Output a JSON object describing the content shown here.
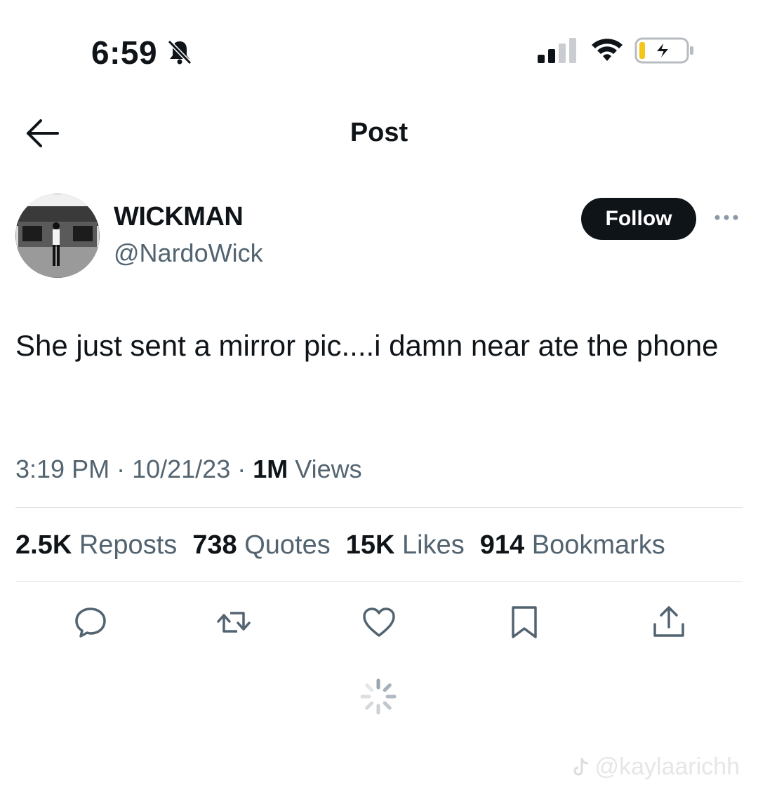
{
  "status_bar": {
    "time": "6:59"
  },
  "nav": {
    "title": "Post"
  },
  "author": {
    "name": "WICKMAN",
    "handle": "@NardoWick",
    "follow_label": "Follow"
  },
  "tweet": {
    "text": "She just sent a mirror pic....i damn near ate the phone",
    "time": "3:19 PM",
    "date": "10/21/23",
    "views_count": "1M",
    "views_label": "Views"
  },
  "stats": [
    {
      "count": "2.5K",
      "label": "Reposts"
    },
    {
      "count": "738",
      "label": "Quotes"
    },
    {
      "count": "15K",
      "label": "Likes"
    },
    {
      "count": "914",
      "label": "Bookmarks"
    }
  ],
  "actions": [
    "reply-icon",
    "repost-icon",
    "like-icon",
    "bookmark-icon",
    "share-icon"
  ],
  "watermark": "@kaylaarichh",
  "colors": {
    "text": "#0f1419",
    "secondary": "#536471",
    "follow_bg": "#0f1419",
    "divider": "#dfe3e6"
  }
}
